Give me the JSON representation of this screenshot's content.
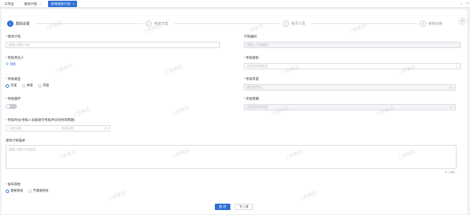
{
  "tabs": [
    {
      "label": "工作台"
    },
    {
      "label": "绩效计划"
    },
    {
      "label": "新增绩效计划"
    }
  ],
  "tab_close_glyph": "×",
  "tab_more_glyph": "⌄",
  "tab_closeall_glyph": "×",
  "steps": [
    {
      "num": "1",
      "label": "基础设置"
    },
    {
      "num": "2",
      "label": "考核方案"
    },
    {
      "num": "3",
      "label": "考评人员"
    },
    {
      "num": "4",
      "label": "考核对象"
    }
  ],
  "collapse_glyph": "‹",
  "form": {
    "plan": {
      "label": "绩效计划",
      "placeholder": "请输入绩效计划"
    },
    "code": {
      "label": "计划编码",
      "placeholder": "请输入计划编码"
    },
    "owner": {
      "label": "考核责任人",
      "add": "⊕ 添加"
    },
    "level": {
      "label": "考核级别",
      "placeholder": "请选择考核级别"
    },
    "type": {
      "label": "考核类型",
      "options": [
        "年度",
        "季度",
        "月度"
      ],
      "selected": "年度"
    },
    "year": {
      "label": "考核年度",
      "placeholder": "请选择年份"
    },
    "cycle": {
      "label": "考核循环",
      "value": false
    },
    "start": {
      "label": "开始周期",
      "placeholder": "请选择开始周期"
    },
    "time": {
      "label": "考核时长(考核人员能进行考核评分的时间周期)",
      "start_placeholder": "开始日期",
      "separator": "—",
      "end_placeholder": "结束日期"
    },
    "desc": {
      "label": "绩效计划描述",
      "placeholder": "请输入绩效计划描述",
      "counter": "0 / 255"
    },
    "publish": {
      "label": "发布审批",
      "options": [
        "需要审批",
        "不需要审批"
      ],
      "selected": "需要审批"
    }
  },
  "buttons": {
    "save": "暂 存",
    "next": "下一步"
  },
  "watermark": "三鼎集团",
  "colors": {
    "accent": "#2f6fd6",
    "required": "#e64545"
  }
}
